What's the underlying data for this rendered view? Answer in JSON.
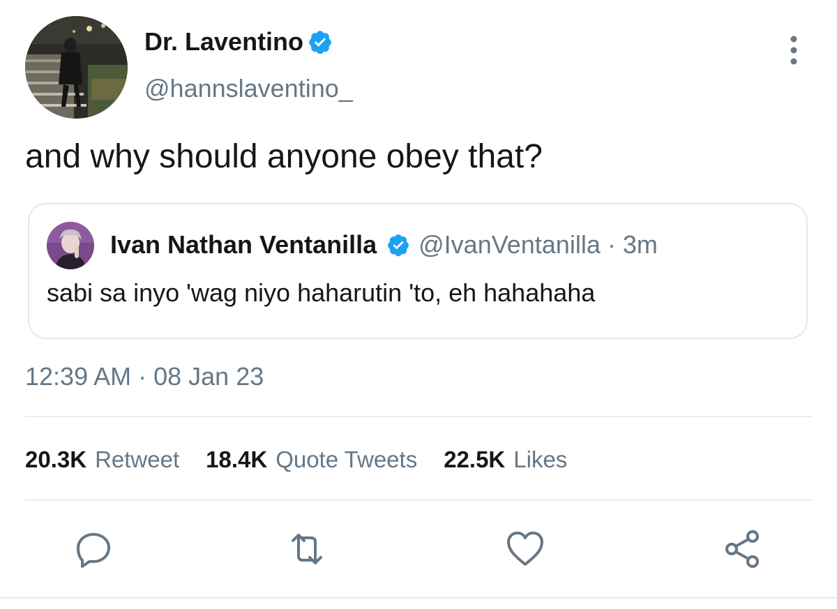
{
  "author": {
    "display_name": "Dr. Laventino",
    "handle": "@hannslaventino_",
    "verified": true
  },
  "tweet": {
    "text": "and why should anyone obey that?",
    "time": "12:39 AM",
    "date": "08 Jan 23",
    "separator": "·"
  },
  "quoted": {
    "display_name": "Ivan Nathan Ventanilla",
    "handle": "@IvanVentanilla",
    "separator": "·",
    "time_ago": "3m",
    "text": "sabi sa inyo 'wag niyo haharutin 'to, eh hahahaha",
    "verified": true
  },
  "stats": {
    "retweets_count": "20.3K",
    "retweets_label": "Retweet",
    "quotes_count": "18.4K",
    "quotes_label": "Quote Tweets",
    "likes_count": "22.5K",
    "likes_label": "Likes"
  },
  "icons": {
    "verified": "verified-badge-icon",
    "more": "more-vertical-icon",
    "reply": "reply-icon",
    "retweet": "retweet-icon",
    "like": "heart-icon",
    "share": "share-icon"
  },
  "colors": {
    "verified_blue": "#1da1f2",
    "secondary_text": "#657786",
    "primary_text": "#14171a",
    "border": "#e1e8ed"
  }
}
